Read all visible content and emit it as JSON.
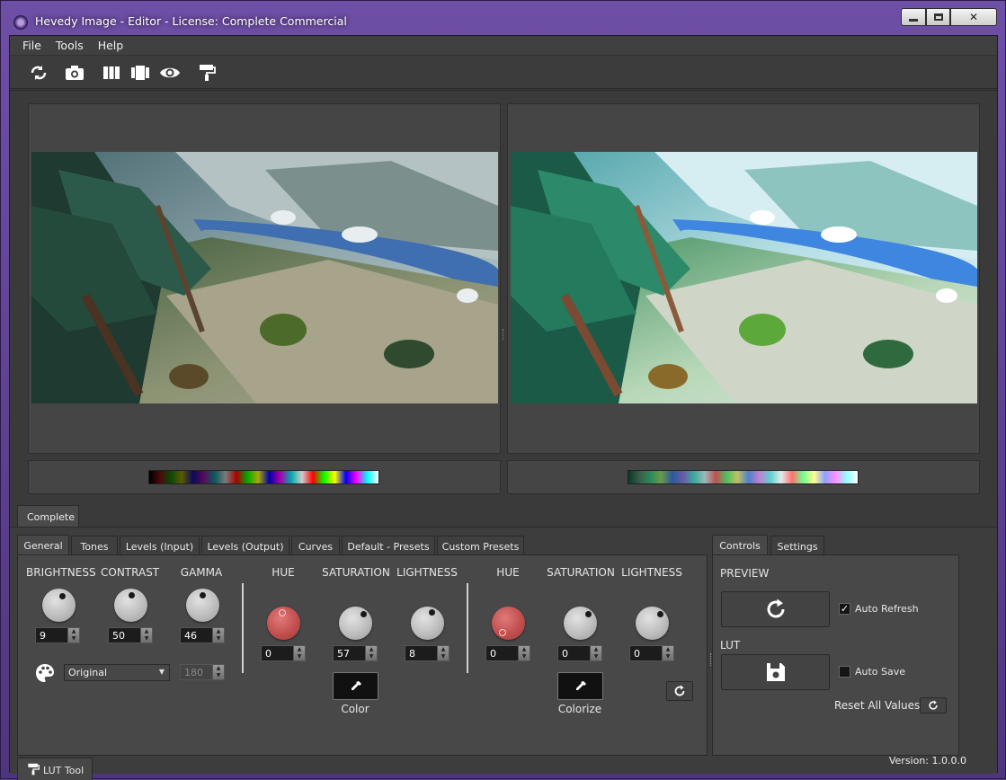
{
  "window": {
    "title": "Hevedy Image - Editor - License: Complete Commercial",
    "min_label": "▬",
    "max_label": "▣",
    "close_label": "✕"
  },
  "menu": {
    "items": [
      {
        "label": "File"
      },
      {
        "label": "Tools"
      },
      {
        "label": "Help"
      }
    ]
  },
  "toolbar": {
    "icons": [
      "refresh-swap-icon",
      "camera-icon",
      "columns-icon",
      "compare-icon",
      "eye-icon",
      "paint-roller-icon"
    ]
  },
  "compare_tab": {
    "label": "Complete"
  },
  "tabs": {
    "labels": [
      "General",
      "Tones",
      "Levels (Input)",
      "Levels (Output)",
      "Curves",
      "Default - Presets",
      "Custom Presets"
    ],
    "active": "General"
  },
  "general": {
    "brightness": {
      "label": "BRIGHTNESS",
      "value": "9"
    },
    "contrast": {
      "label": "CONTRAST",
      "value": "50"
    },
    "gamma": {
      "label": "GAMMA",
      "value": "46"
    },
    "color_group": {
      "hue": {
        "label": "HUE",
        "value": "0"
      },
      "saturation": {
        "label": "SATURATION",
        "value": "57"
      },
      "lightness": {
        "label": "LIGHTNESS",
        "value": "8"
      },
      "button_label": "Color"
    },
    "colorize_group": {
      "hue": {
        "label": "HUE",
        "value": "0"
      },
      "saturation": {
        "label": "SATURATION",
        "value": "0"
      },
      "lightness": {
        "label": "LIGHTNESS",
        "value": "0"
      },
      "button_label": "Colorize"
    },
    "mode_select": {
      "value": "Original"
    },
    "angle_spin": {
      "value": "180"
    }
  },
  "right_tabs": {
    "labels": [
      "Controls",
      "Settings"
    ],
    "active": "Controls"
  },
  "controls": {
    "preview_label": "PREVIEW",
    "auto_refresh_label": "Auto Refresh",
    "auto_refresh_checked": "✓",
    "lut_label": "LUT",
    "auto_save_label": "Auto Save",
    "reset_label": "Reset All Values"
  },
  "lut_tool_tab": {
    "label": "LUT Tool"
  },
  "status": {
    "version": "Version: 1.0.0.0"
  },
  "colors": {
    "accent_red_knob": "#c24f4f",
    "panel_bg": "#454545"
  }
}
